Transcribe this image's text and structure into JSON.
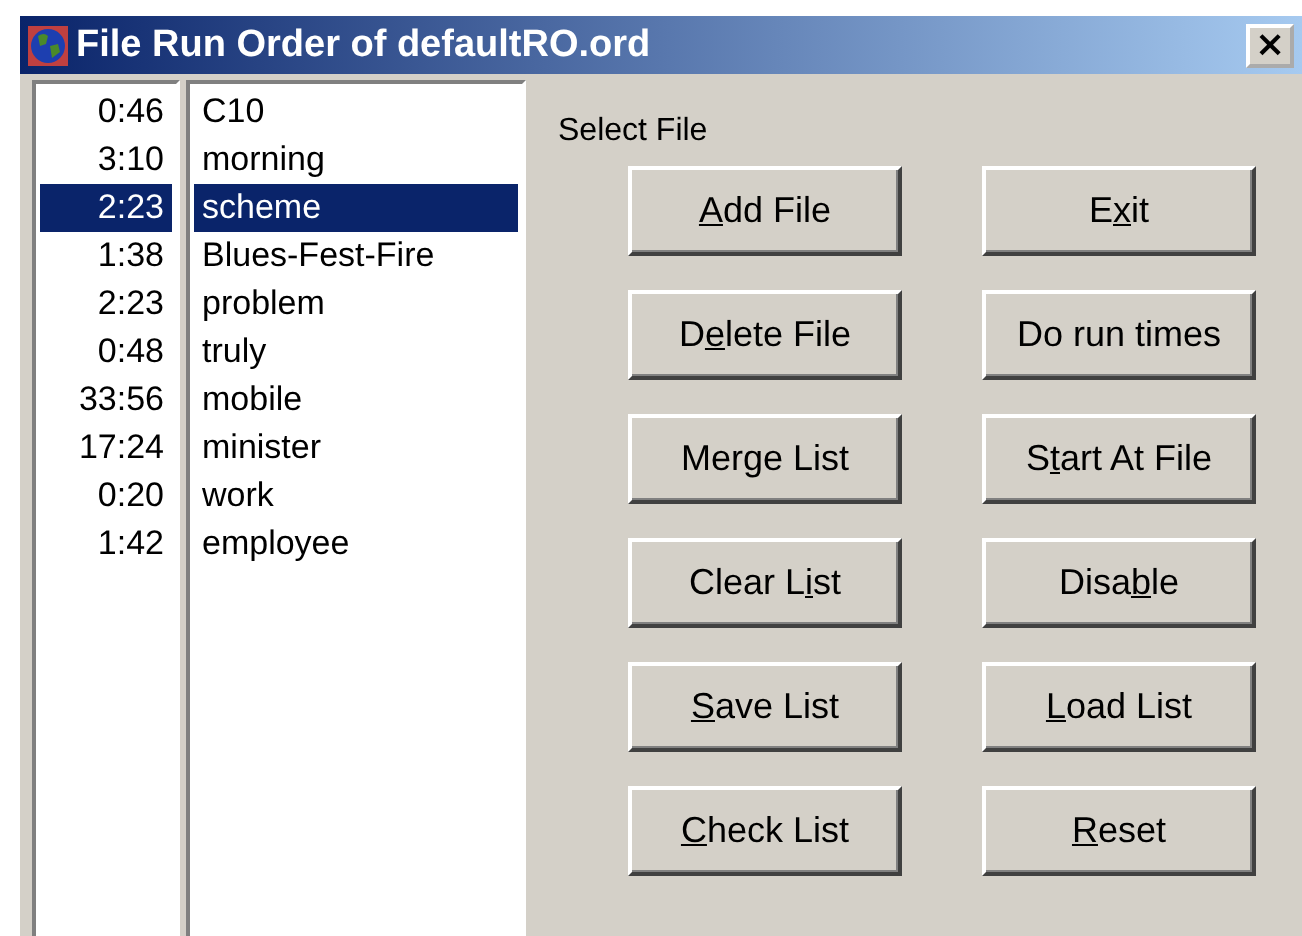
{
  "window": {
    "title": "File Run Order of defaultRO.ord",
    "close": "×"
  },
  "rows": [
    {
      "time": "0:46",
      "name": "C10",
      "selected": false
    },
    {
      "time": "3:10",
      "name": "morning",
      "selected": false
    },
    {
      "time": "2:23",
      "name": "scheme",
      "selected": true
    },
    {
      "time": "1:38",
      "name": "Blues-Fest-Fire",
      "selected": false
    },
    {
      "time": "2:23",
      "name": "problem",
      "selected": false
    },
    {
      "time": "0:48",
      "name": "truly",
      "selected": false
    },
    {
      "time": "33:56",
      "name": "mobile",
      "selected": false
    },
    {
      "time": "17:24",
      "name": "minister",
      "selected": false
    },
    {
      "time": "0:20",
      "name": "work",
      "selected": false
    },
    {
      "time": "1:42",
      "name": "employee",
      "selected": false
    }
  ],
  "select_label": "Select File",
  "buttons": [
    {
      "key": "A",
      "after": "dd File"
    },
    {
      "before": "E",
      "key": "x",
      "after": "it"
    },
    {
      "before": "D",
      "key": "e",
      "after": "lete File"
    },
    {
      "before": "Do run times"
    },
    {
      "before": "Merge List"
    },
    {
      "before": "S",
      "key": "t",
      "after": "art At File"
    },
    {
      "before": "Clear L",
      "key": "i",
      "after": "st"
    },
    {
      "before": "Disa",
      "key": "b",
      "after": "le"
    },
    {
      "key": "S",
      "after": "ave List"
    },
    {
      "key": "L",
      "after": "oad List"
    },
    {
      "key": "C",
      "after": "heck List"
    },
    {
      "key": "R",
      "after": "eset"
    }
  ]
}
